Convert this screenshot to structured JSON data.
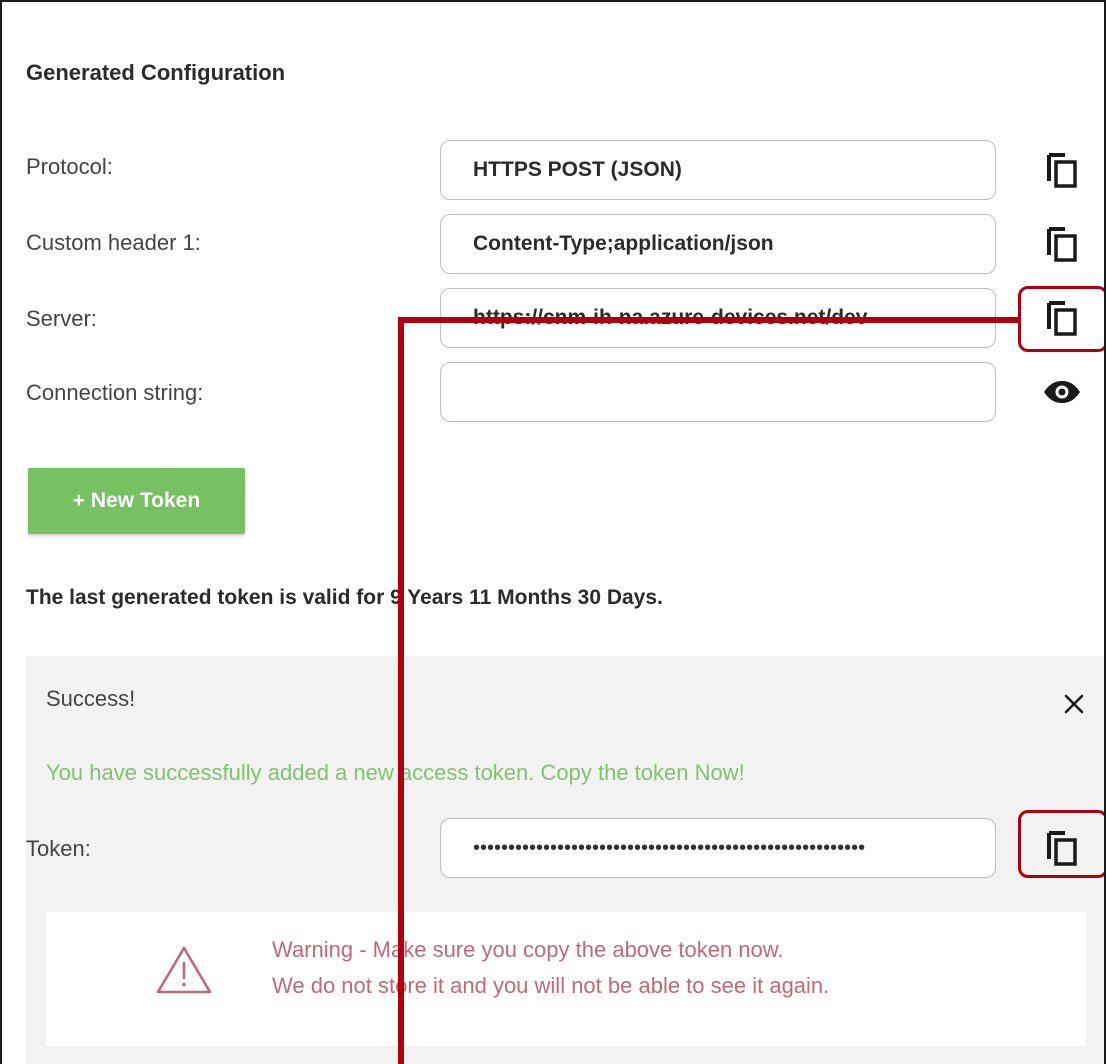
{
  "section": {
    "title": "Generated Configuration"
  },
  "fields": [
    {
      "label": "Protocol:",
      "value": "HTTPS POST (JSON)",
      "action_icon": "copy-icon"
    },
    {
      "label": "Custom header 1:",
      "value": "Content-Type;application/json",
      "action_icon": "copy-icon"
    },
    {
      "label": "Server:",
      "value": "https://cnm-ih-na.azure-devices.net/dev",
      "action_icon": "copy-icon"
    },
    {
      "label": "Connection string:",
      "value": "",
      "action_icon": "eye-icon"
    }
  ],
  "new_token_button": {
    "label": "+ New Token"
  },
  "validity_text": "The last generated token is valid for 9 Years 11 Months 30 Days.",
  "success_panel": {
    "title": "Success!",
    "message": "You have successfully added a new access token. Copy the token Now!",
    "token_label": "Token:",
    "token_value": "••••••••••••••••••••••••••••••••••••••••••••••••••••••••",
    "close_icon": "close-icon",
    "copy_icon": "copy-icon"
  },
  "warning": {
    "icon": "warning-icon",
    "line1": "Warning - Make sure you copy the above token now.",
    "line2": "We do not store it and you will not be able to see it again."
  },
  "colors": {
    "button_green": "#77c162",
    "success_green": "#7fc36a",
    "warning_red": "#c06a78",
    "highlight_red": "#b00010",
    "panel_bg": "#f2f2f2"
  }
}
